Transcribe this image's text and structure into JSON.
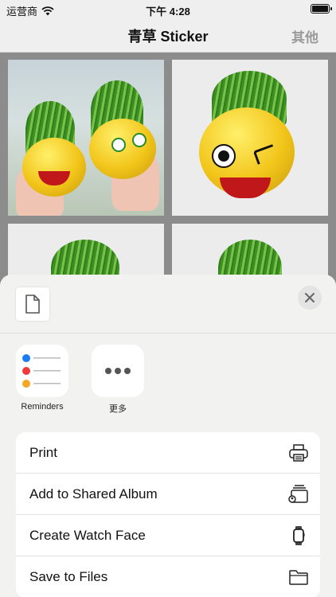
{
  "status_bar": {
    "carrier": "运营商",
    "time": "下午 4:28"
  },
  "nav": {
    "title": "青草 Sticker",
    "right_button": "其他"
  },
  "grid": {
    "tiles": [
      "sticker-1",
      "sticker-2",
      "sticker-3",
      "sticker-4"
    ]
  },
  "share_sheet": {
    "apps": [
      {
        "label": "Reminders",
        "icon": "reminders-icon"
      },
      {
        "label": "更多",
        "icon": "more-icon"
      }
    ],
    "actions": [
      {
        "label": "Print",
        "icon": "printer-icon"
      },
      {
        "label": "Add to Shared Album",
        "icon": "shared-album-icon"
      },
      {
        "label": "Create Watch Face",
        "icon": "watch-icon"
      },
      {
        "label": "Save to Files",
        "icon": "folder-icon"
      }
    ]
  },
  "colors": {
    "accent_grass": "#5fae34",
    "pot_yellow": "#f2c51a",
    "sheet_bg": "#f2f2f0"
  }
}
